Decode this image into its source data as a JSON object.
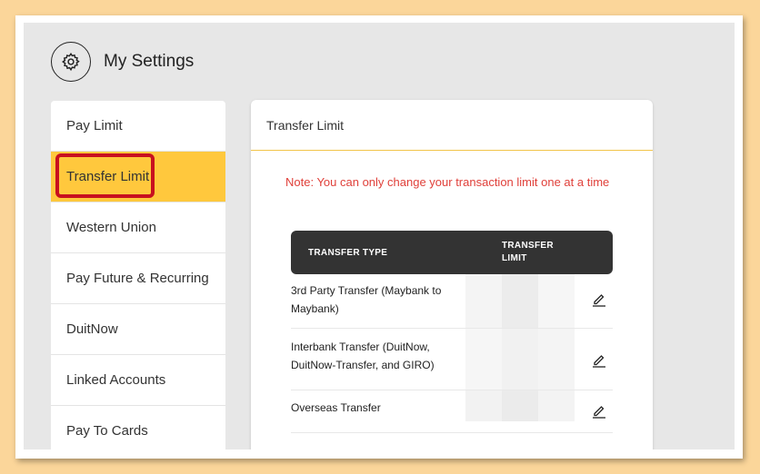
{
  "header": {
    "title": "My Settings",
    "icon": "gear-icon"
  },
  "sidebar": {
    "items": [
      {
        "label": "Pay Limit",
        "active": false
      },
      {
        "label": "Transfer Limit",
        "active": true
      },
      {
        "label": "Western Union",
        "active": false
      },
      {
        "label": "Pay Future & Recurring",
        "active": false
      },
      {
        "label": "DuitNow",
        "active": false
      },
      {
        "label": "Linked Accounts",
        "active": false
      },
      {
        "label": "Pay To Cards",
        "active": false
      }
    ]
  },
  "panel": {
    "title": "Transfer Limit",
    "note": "Note: You can only change your transaction limit one at a time",
    "table": {
      "col_type": "TRANSFER TYPE",
      "col_limit": "TRANSFER LIMIT",
      "rows": [
        {
          "type": "3rd Party Transfer (Maybank to Maybank)"
        },
        {
          "type": "Interbank Transfer (DuitNow, DuitNow-Transfer, and GIRO)"
        },
        {
          "type": "Overseas Transfer"
        }
      ]
    }
  },
  "colors": {
    "accent": "#ffc83d",
    "note": "#e0403a",
    "table_header": "#333333",
    "highlight": "#c8101f"
  }
}
